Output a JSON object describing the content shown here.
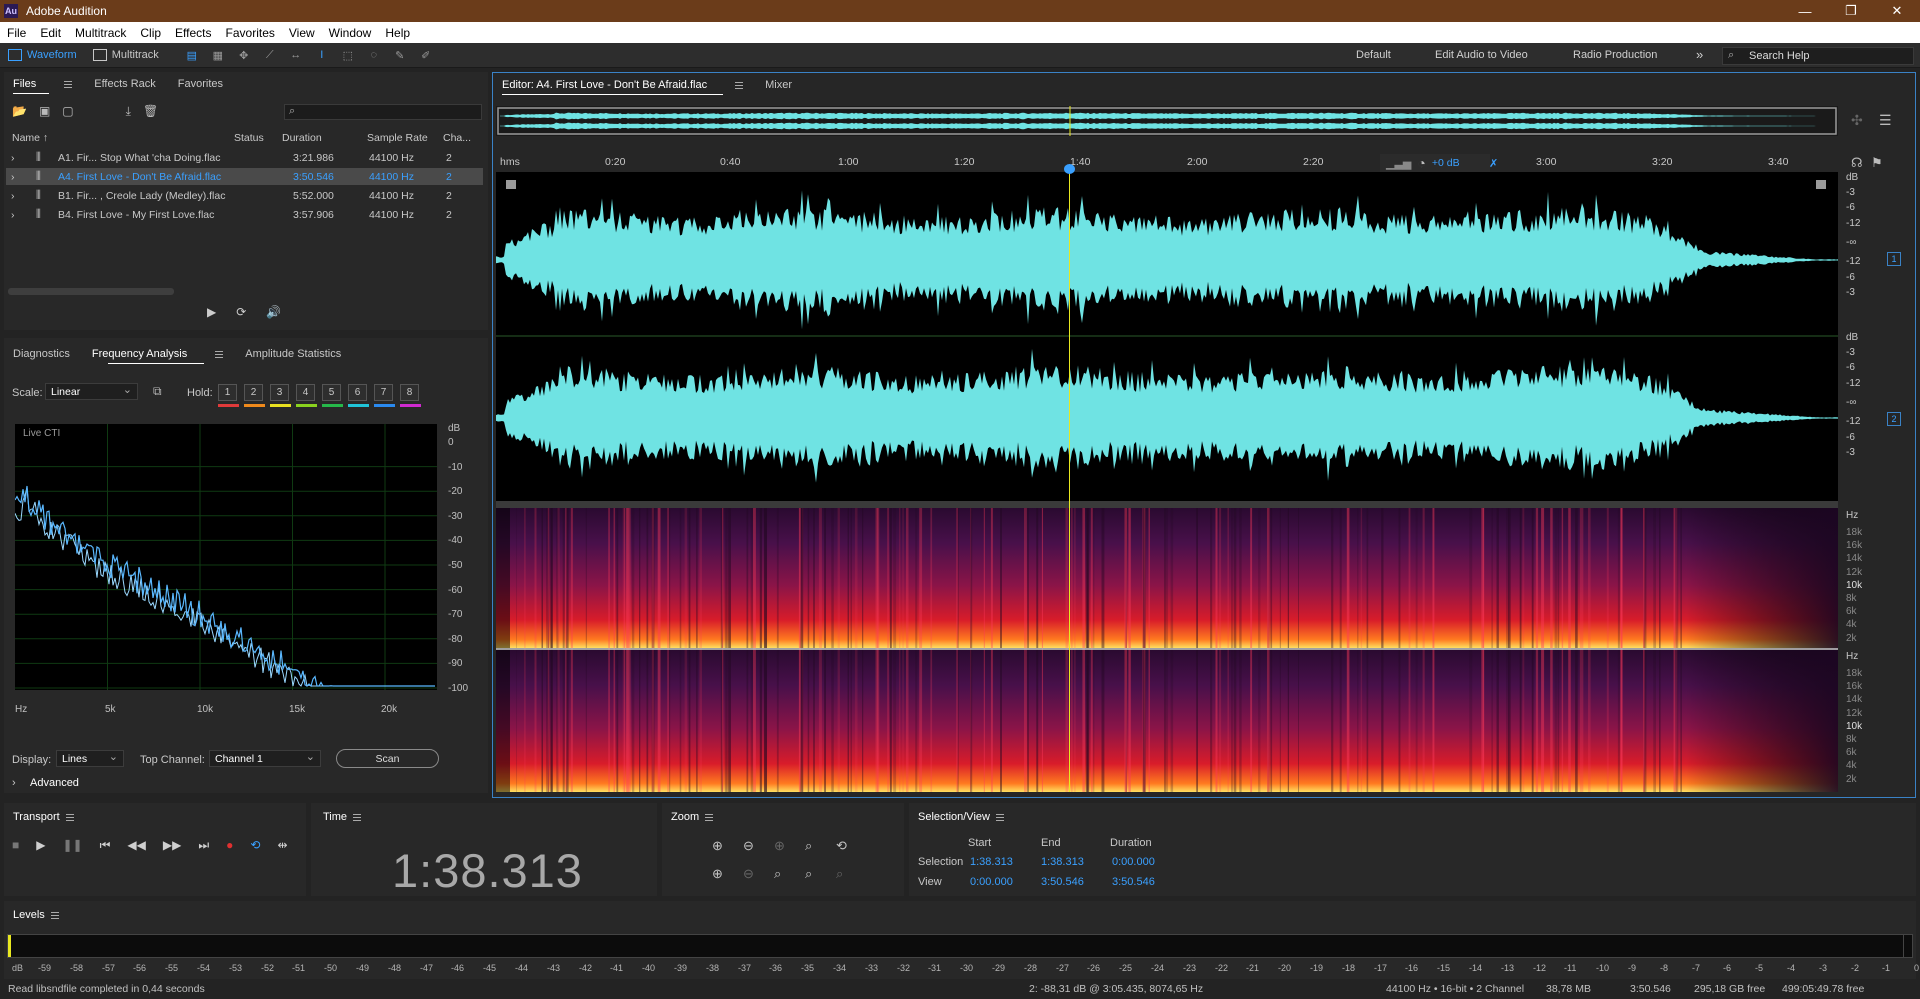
{
  "window": {
    "app_icon": "Au",
    "title": "Adobe Audition",
    "controls": [
      "—",
      "❐",
      "✕"
    ]
  },
  "menu": [
    "File",
    "Edit",
    "Multitrack",
    "Clip",
    "Effects",
    "Favorites",
    "View",
    "Window",
    "Help"
  ],
  "toolbar": {
    "waveform_label": "Waveform",
    "multitrack_label": "Multitrack"
  },
  "workspaces": [
    "Default",
    "Edit Audio to Video",
    "Radio Production"
  ],
  "workspace_more": "»",
  "search_placeholder": "Search Help",
  "files_panel": {
    "tabs": [
      "Files",
      "Effects Rack",
      "Favorites"
    ],
    "search_glyph": "⌕",
    "columns": [
      "Name ↑",
      "Status",
      "Duration",
      "Sample Rate",
      "Cha..."
    ],
    "rows": [
      {
        "name": "A1. Fir... Stop What 'cha Doing.flac",
        "duration": "3:21.986",
        "rate": "44100 Hz",
        "ch": "2"
      },
      {
        "name": "A4. First Love - Don't Be Afraid.flac",
        "duration": "3:50.546",
        "rate": "44100 Hz",
        "ch": "2"
      },
      {
        "name": "B1. Fir... , Creole Lady (Medley).flac",
        "duration": "5:52.000",
        "rate": "44100 Hz",
        "ch": "2"
      },
      {
        "name": "B4. First Love - My First Love.flac",
        "duration": "3:57.906",
        "rate": "44100 Hz",
        "ch": "2"
      }
    ],
    "selected_index": 1
  },
  "analysis_panel": {
    "tabs": [
      "Diagnostics",
      "Frequency Analysis",
      "Amplitude Statistics"
    ],
    "scale_label": "Scale:",
    "scale_value": "Linear",
    "hold_label": "Hold:",
    "hold_buttons": [
      "1",
      "2",
      "3",
      "4",
      "5",
      "6",
      "7",
      "8"
    ],
    "hold_colors": [
      "#e03a3a",
      "#f08a1c",
      "#e8e020",
      "#8ad21e",
      "#26b84a",
      "#20c4d8",
      "#2a8af0",
      "#d02ad0"
    ],
    "live_label": "Live CTI",
    "db_labels": [
      "dB",
      "0",
      "-10",
      "-20",
      "-30",
      "-40",
      "-50",
      "-60",
      "-70",
      "-80",
      "-90",
      "-100"
    ],
    "hz_labels": [
      "Hz",
      "5k",
      "10k",
      "15k",
      "20k"
    ],
    "display_label": "Display:",
    "display_value": "Lines",
    "top_channel_label": "Top Channel:",
    "top_channel_value": "Channel 1",
    "scan_label": "Scan",
    "advanced_label": "Advanced"
  },
  "editor": {
    "tab_label": "Editor: A4. First Love - Don't Be Afraid.flac",
    "mixer_label": "Mixer",
    "ruler_labels": [
      "hms",
      "0:20",
      "0:40",
      "1:00",
      "1:20",
      "1:40",
      "2:00",
      "2:20",
      "3:00",
      "3:20",
      "3:40"
    ],
    "gain_label": "+0 dB",
    "db_scale": [
      "dB",
      "-3",
      "-6",
      "-12",
      "-∞",
      "-12",
      "-6",
      "-3"
    ],
    "hz_scale": [
      "Hz",
      "18k",
      "16k",
      "14k",
      "12k",
      "10k",
      "8k",
      "6k",
      "4k",
      "2k"
    ],
    "channel_numbers": [
      "1",
      "2"
    ],
    "playhead_time": "1:38.313"
  },
  "transport": {
    "title": "Transport"
  },
  "time_panel": {
    "title": "Time",
    "value": "1:38.313"
  },
  "zoom_panel": {
    "title": "Zoom"
  },
  "selection_panel": {
    "title": "Selection/View",
    "headers": [
      "Start",
      "End",
      "Duration"
    ],
    "selection_label": "Selection",
    "view_label": "View",
    "selection": [
      "1:38.313",
      "1:38.313",
      "0:00.000"
    ],
    "view": [
      "0:00.000",
      "3:50.546",
      "3:50.546"
    ]
  },
  "levels": {
    "title": "Levels",
    "scale": [
      "dB",
      "-59",
      "-58",
      "-57",
      "-56",
      "-55",
      "-54",
      "-53",
      "-52",
      "-51",
      "-50",
      "-49",
      "-48",
      "-47",
      "-46",
      "-45",
      "-44",
      "-43",
      "-42",
      "-41",
      "-40",
      "-39",
      "-38",
      "-37",
      "-36",
      "-35",
      "-34",
      "-33",
      "-32",
      "-31",
      "-30",
      "-29",
      "-28",
      "-27",
      "-26",
      "-25",
      "-24",
      "-23",
      "-22",
      "-21",
      "-20",
      "-19",
      "-18",
      "-17",
      "-16",
      "-15",
      "-14",
      "-13",
      "-12",
      "-11",
      "-10",
      "-9",
      "-8",
      "-7",
      "-6",
      "-5",
      "-4",
      "-3",
      "-2",
      "-1",
      "0"
    ]
  },
  "status": {
    "message": "Read libsndfile completed in 0,44 seconds",
    "cursor": "2: -88,31 dB @ 3:05.435, 8074,65 Hz",
    "format": "44100 Hz • 16-bit • 2 Channel",
    "size": "38,78 MB",
    "duration": "3:50.546",
    "free": "295,18 GB free",
    "free_time": "499:05:49.78 free"
  },
  "colors": {
    "accent": "#3aa0ff",
    "waveform": "#6fe3e3",
    "record": "#e03030",
    "titlebar": "#6b3c1a"
  }
}
